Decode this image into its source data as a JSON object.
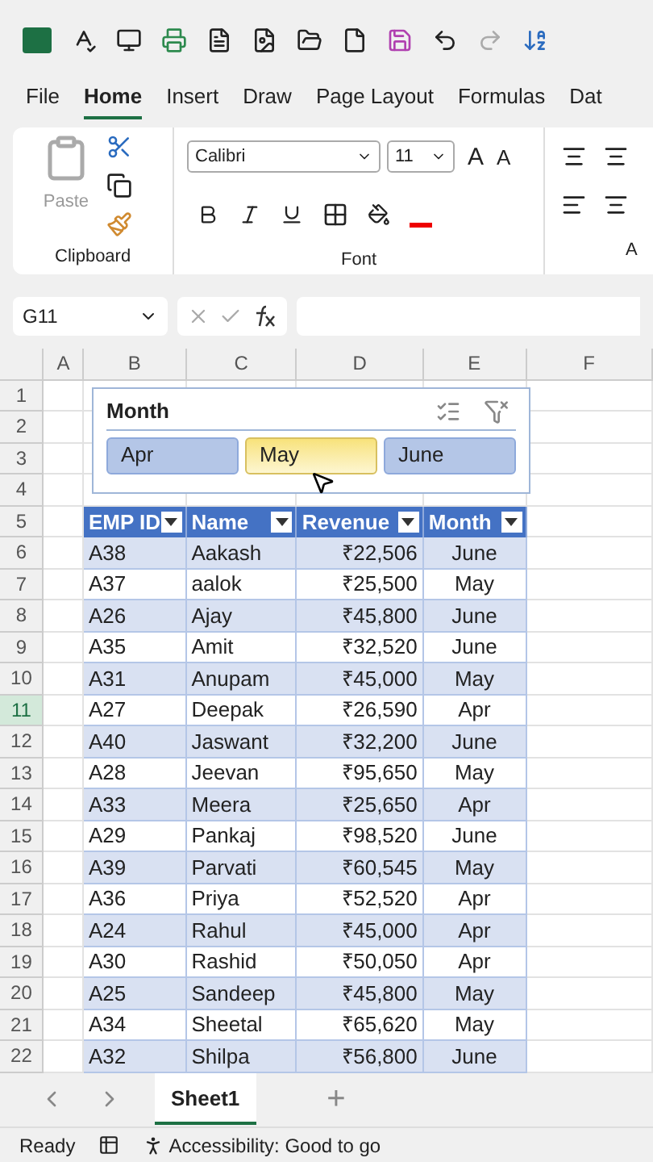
{
  "menu_tabs": [
    {
      "label": "File",
      "selected": false
    },
    {
      "label": "Home",
      "selected": true
    },
    {
      "label": "Insert",
      "selected": false
    },
    {
      "label": "Draw",
      "selected": false
    },
    {
      "label": "Page Layout",
      "selected": false
    },
    {
      "label": "Formulas",
      "selected": false
    },
    {
      "label": "Dat",
      "selected": false
    }
  ],
  "ribbon": {
    "paste_label": "Paste",
    "font_name": "Calibri",
    "font_size": "11",
    "grow_font": "A",
    "shrink_font": "A",
    "groups": [
      "Clipboard",
      "Font",
      "A"
    ]
  },
  "formula_bar": {
    "name_box": "G11"
  },
  "columns": [
    "A",
    "B",
    "C",
    "D",
    "E",
    "F"
  ],
  "row_headers": [
    {
      "label": "1",
      "selected": false
    },
    {
      "label": "2",
      "selected": false
    },
    {
      "label": "3",
      "selected": false
    },
    {
      "label": "4",
      "selected": false
    },
    {
      "label": "5",
      "selected": false
    },
    {
      "label": "6",
      "selected": false
    },
    {
      "label": "7",
      "selected": false
    },
    {
      "label": "8",
      "selected": false
    },
    {
      "label": "9",
      "selected": false
    },
    {
      "label": "10",
      "selected": false
    },
    {
      "label": "11",
      "selected": true
    },
    {
      "label": "12",
      "selected": false
    },
    {
      "label": "13",
      "selected": false
    },
    {
      "label": "14",
      "selected": false
    },
    {
      "label": "15",
      "selected": false
    },
    {
      "label": "16",
      "selected": false
    },
    {
      "label": "17",
      "selected": false
    },
    {
      "label": "18",
      "selected": false
    },
    {
      "label": "19",
      "selected": false
    },
    {
      "label": "20",
      "selected": false
    },
    {
      "label": "21",
      "selected": false
    },
    {
      "label": "22",
      "selected": false
    }
  ],
  "slicer": {
    "title": "Month",
    "buttons": [
      {
        "label": "Apr",
        "selected": false
      },
      {
        "label": "May",
        "selected": true
      },
      {
        "label": "June",
        "selected": false
      }
    ]
  },
  "table": {
    "columns": [
      "EMP ID",
      "Name",
      "Revenue",
      "Month"
    ],
    "rows": [
      [
        "A38",
        "Aakash",
        "₹22,506",
        "June"
      ],
      [
        "A37",
        "aalok",
        "₹25,500",
        "May"
      ],
      [
        "A26",
        "Ajay",
        "₹45,800",
        "June"
      ],
      [
        "A35",
        "Amit",
        "₹32,520",
        "June"
      ],
      [
        "A31",
        "Anupam",
        "₹45,000",
        "May"
      ],
      [
        "A27",
        "Deepak",
        "₹26,590",
        "Apr"
      ],
      [
        "A40",
        "Jaswant",
        "₹32,200",
        "June"
      ],
      [
        "A28",
        "Jeevan",
        "₹95,650",
        "May"
      ],
      [
        "A33",
        "Meera",
        "₹25,650",
        "Apr"
      ],
      [
        "A29",
        "Pankaj",
        "₹98,520",
        "June"
      ],
      [
        "A39",
        "Parvati",
        "₹60,545",
        "May"
      ],
      [
        "A36",
        "Priya",
        "₹52,520",
        "Apr"
      ],
      [
        "A24",
        "Rahul",
        "₹45,000",
        "Apr"
      ],
      [
        "A30",
        "Rashid",
        "₹50,050",
        "Apr"
      ],
      [
        "A25",
        "Sandeep",
        "₹45,800",
        "May"
      ],
      [
        "A34",
        "Sheetal",
        "₹65,620",
        "May"
      ],
      [
        "A32",
        "Shilpa",
        "₹56,800",
        "June"
      ]
    ]
  },
  "sheet_tabs": [
    {
      "label": "Sheet1",
      "selected": true
    }
  ],
  "add_sheet": "+",
  "status_bar": {
    "mode": "Ready",
    "accessibility": "Accessibility: Good to go"
  }
}
